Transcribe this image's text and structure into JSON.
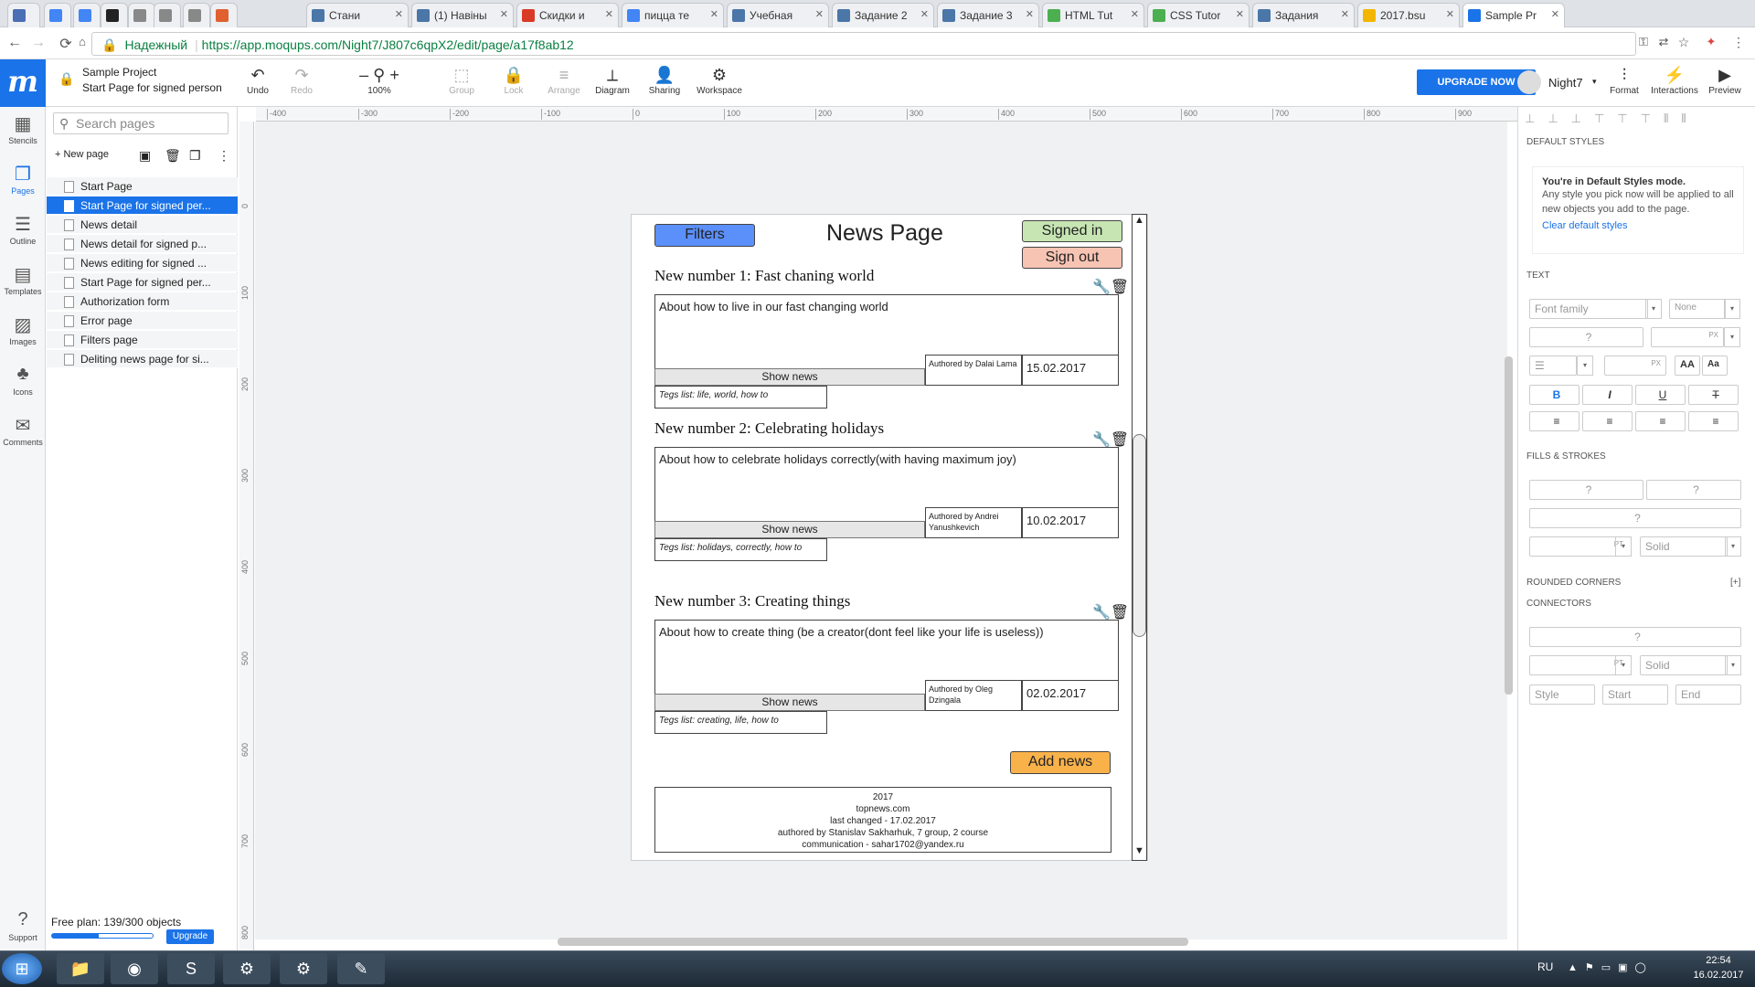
{
  "browser": {
    "tabs": [
      {
        "label": "",
        "color": "#4b6fb5"
      },
      {
        "label": "",
        "color": "#4285f4"
      },
      {
        "label": "",
        "color": "#4285f4"
      },
      {
        "label": "",
        "color": "#222222"
      },
      {
        "label": "",
        "color": "#888888"
      },
      {
        "label": "",
        "color": "#888888"
      },
      {
        "label": "",
        "color": "#888888"
      },
      {
        "label": "",
        "color": "#e0602f"
      },
      {
        "label": "Стани",
        "color": "#4a76a8"
      },
      {
        "label": "(1) Навіны",
        "color": "#4a76a8"
      },
      {
        "label": "Скидки и",
        "color": "#d93a25"
      },
      {
        "label": "пицца те",
        "color": "#4285f4"
      },
      {
        "label": "Учебная",
        "color": "#4a76a8"
      },
      {
        "label": "Задание 2",
        "color": "#4a76a8"
      },
      {
        "label": "Задание 3",
        "color": "#4a76a8"
      },
      {
        "label": "HTML Tut",
        "color": "#4caf50"
      },
      {
        "label": "CSS Tutor",
        "color": "#4caf50"
      },
      {
        "label": "Задания",
        "color": "#4a76a8"
      },
      {
        "label": "2017.bsu",
        "color": "#f2b600"
      },
      {
        "label": "Sample Pr",
        "color": "#1a73e8"
      }
    ],
    "secure_label": "Надежный",
    "url": "https://app.moqups.com/Night7/J807c6qpX2/edit/page/a17f8ab12"
  },
  "app": {
    "project_name": "Sample Project",
    "page_name": "Start Page for signed person",
    "tools": [
      {
        "label": "Undo",
        "icon": "↶",
        "disabled": false
      },
      {
        "label": "Redo",
        "icon": "↷",
        "disabled": true
      },
      {
        "label": "100%",
        "icon": "– ⚲ +",
        "disabled": false
      },
      {
        "label": "Group",
        "icon": "⬚",
        "disabled": true
      },
      {
        "label": "Lock",
        "icon": "🔒",
        "disabled": true
      },
      {
        "label": "Arrange",
        "icon": "≡",
        "disabled": true
      },
      {
        "label": "Diagram",
        "icon": "⟂",
        "disabled": false
      },
      {
        "label": "Sharing",
        "icon": "👤",
        "disabled": false
      },
      {
        "label": "Workspace",
        "icon": "⚙",
        "disabled": false
      }
    ],
    "upgrade_now": "UPGRADE NOW",
    "user_name": "Night7",
    "right_tools": [
      {
        "label": "Format",
        "icon": "⫶"
      },
      {
        "label": "Interactions",
        "icon": "⚡"
      },
      {
        "label": "Preview",
        "icon": "▶"
      }
    ]
  },
  "leftbar": [
    {
      "label": "Stencils",
      "icon": "▦",
      "active": false
    },
    {
      "label": "Pages",
      "icon": "❐",
      "active": true
    },
    {
      "label": "Outline",
      "icon": "☰",
      "active": false
    },
    {
      "label": "Templates",
      "icon": "▤",
      "active": false
    },
    {
      "label": "Images",
      "icon": "▨",
      "active": false
    },
    {
      "label": "Icons",
      "icon": "♣",
      "active": false
    },
    {
      "label": "Comments",
      "icon": "✉",
      "active": false
    }
  ],
  "support_label": "Support",
  "pages_panel": {
    "search_placeholder": "Search pages",
    "new_page": "New page",
    "pages": [
      "Start Page",
      "Start Page for signed per...",
      "News detail",
      "News detail for signed p...",
      "News editing for signed ...",
      "Start Page for signed per...",
      "Authorization form",
      "Error page",
      "Filters page",
      "Deliting news page for si..."
    ],
    "selected_index": 1,
    "plan_text": "Free plan: 139/300 objects",
    "plan_used_fraction": 0.463,
    "upgrade": "Upgrade"
  },
  "ruler": {
    "h_labels": [
      "-400",
      "-300",
      "-200",
      "-100",
      "0",
      "100",
      "200",
      "300",
      "400",
      "500",
      "600",
      "700",
      "800",
      "900"
    ],
    "v_labels": [
      "0",
      "100",
      "200",
      "300",
      "400",
      "500",
      "600",
      "700",
      "800"
    ]
  },
  "mockup": {
    "filters": "Filters",
    "title": "News Page",
    "signed_in": "Signed in",
    "sign_out": "Sign out",
    "news": [
      {
        "title": "New number 1: Fast chaning world",
        "text": "About how to live in our fast changing world",
        "show": "Show news",
        "author": "Authored by Dalai Lama",
        "date": "15.02.2017",
        "tags": "Tegs list: life, world, how to"
      },
      {
        "title": "New number 2: Celebrating holidays",
        "text": "About how to celebrate holidays correctly(with having maximum joy)",
        "show": "Show news",
        "author": "Authored by Andrei Yanushkevich",
        "date": "10.02.2017",
        "tags": "Tegs list: holidays, correctly, how to"
      },
      {
        "title": "New number 3: Creating things",
        "text": "About how to create thing (be a creator(dont feel like your life is useless))",
        "show": "Show news",
        "author": "Authored by Oleg Dzingala",
        "date": "02.02.2017",
        "tags": "Tegs list: creating, life, how to"
      }
    ],
    "add_news": "Add news",
    "footer": [
      "2017",
      "topnews.com",
      "last changed - 17.02.2017",
      "authored by Stanislav Sakharhuk, 7 group, 2 course",
      "communication - sahar1702@yandex.ru"
    ],
    "colors": {
      "filters": "#5b8ff9",
      "signed_in": "#c6e5b3",
      "sign_out": "#f7c4b4",
      "add_news": "#f9b24a"
    }
  },
  "right_panel": {
    "default_styles": "DEFAULT STYLES",
    "info_title": "You're in Default Styles mode.",
    "info_text": "Any style you pick now will be applied to all new objects you add to the page.",
    "clear_link": "Clear default styles",
    "text_section": "TEXT",
    "font_family": "Font family",
    "none": "None",
    "fills_section": "FILLS & STROKES",
    "rounded": "ROUNDED CORNERS",
    "rounded_plus": "[+]",
    "connectors": "CONNECTORS",
    "solid": "Solid",
    "q": "?",
    "pt": "PT",
    "px": "PX",
    "style": "Style",
    "start": "Start",
    "end": "End"
  },
  "taskbar": {
    "lang": "RU",
    "time": "22:54",
    "date": "16.02.2017"
  }
}
